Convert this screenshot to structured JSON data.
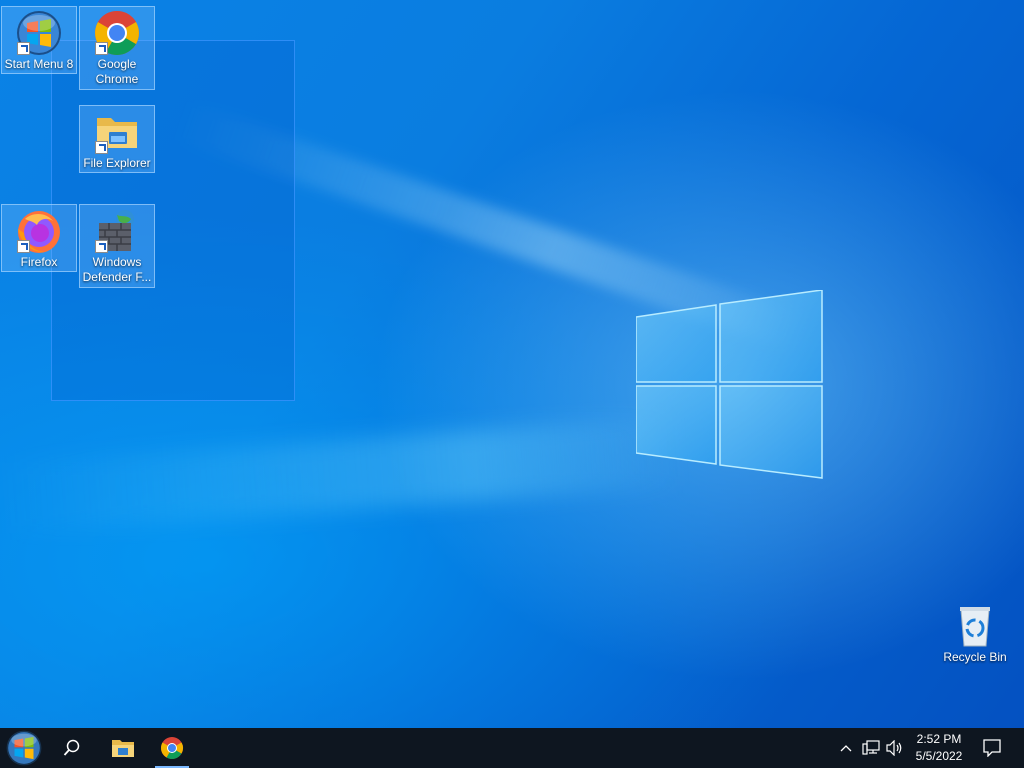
{
  "desktop": {
    "icons": [
      {
        "label": "Start Menu 8",
        "icon": "start-orb-icon"
      },
      {
        "label": "Google Chrome",
        "icon": "chrome-icon"
      },
      {
        "label": "File Explorer",
        "icon": "folder-icon"
      },
      {
        "label": "Firefox",
        "icon": "firefox-icon"
      },
      {
        "label": "Windows Defender F...",
        "icon": "firewall-icon"
      },
      {
        "label": "Recycle Bin",
        "icon": "recycle-bin-icon"
      }
    ]
  },
  "taskbar": {
    "pinned": [
      {
        "name": "start-button",
        "icon": "start-orb-icon"
      },
      {
        "name": "search-button",
        "icon": "search-icon"
      },
      {
        "name": "file-explorer-button",
        "icon": "folder-icon"
      },
      {
        "name": "chrome-button",
        "icon": "chrome-icon",
        "active": true
      }
    ],
    "tray": {
      "icons": [
        "chevron-up-icon",
        "network-icon",
        "volume-icon"
      ],
      "time": "2:52 PM",
      "date": "5/5/2022",
      "notification_icon": "notification-icon"
    }
  },
  "colors": {
    "taskbar": "#0e1620",
    "accent": "#0a7de0"
  }
}
